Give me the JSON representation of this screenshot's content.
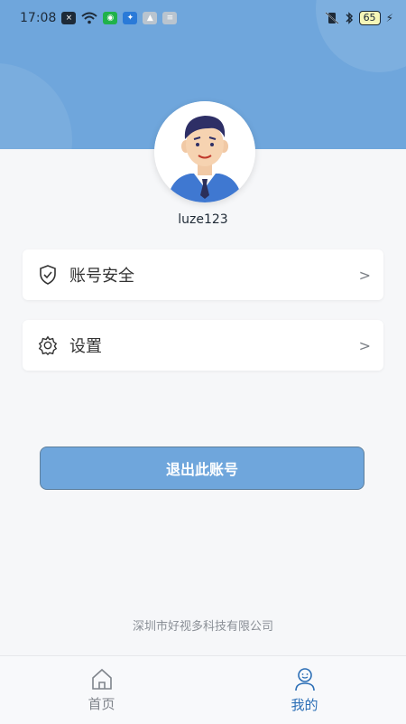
{
  "status_bar": {
    "time": "17:08",
    "battery": "65"
  },
  "profile": {
    "username": "luze123"
  },
  "menu": [
    {
      "label": "账号安全",
      "icon": "shield-check-icon"
    },
    {
      "label": "设置",
      "icon": "gear-icon"
    }
  ],
  "logout_label": "退出此账号",
  "footer_company": "深圳市好视多科技有限公司",
  "bottom_nav": [
    {
      "label": "首页",
      "icon": "home-icon",
      "active": false
    },
    {
      "label": "我的",
      "icon": "user-icon",
      "active": true
    }
  ],
  "colors": {
    "primary": "#6fa6dc",
    "active_nav": "#2c6fb6",
    "background": "#f6f7f9"
  }
}
